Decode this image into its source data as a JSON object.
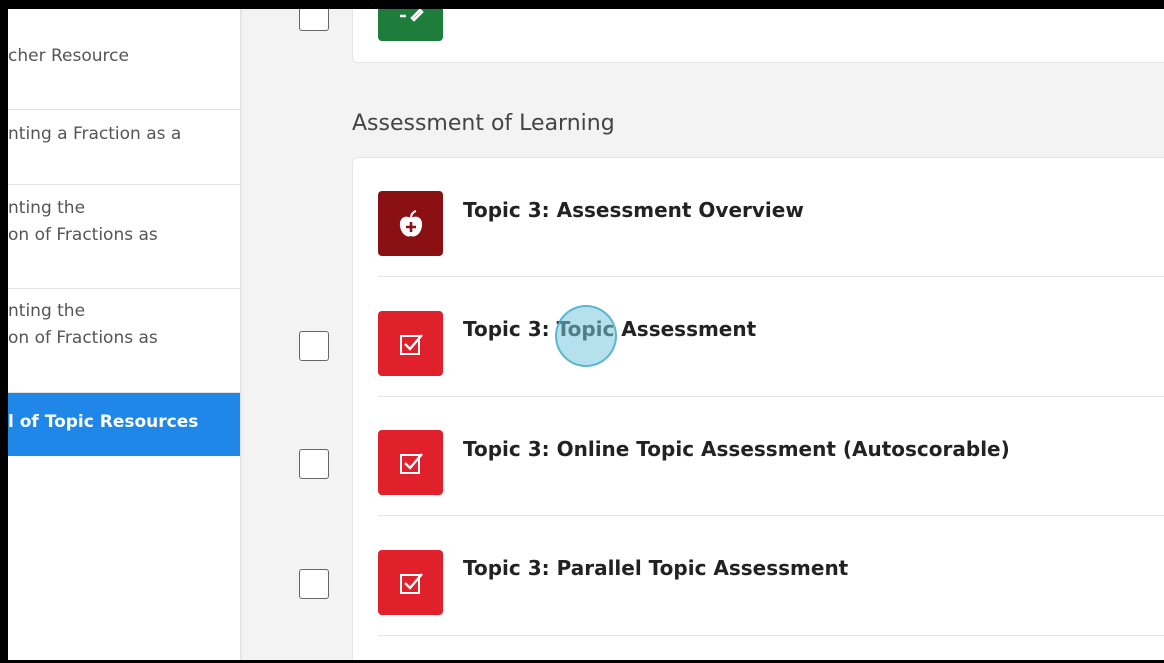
{
  "sidebar": {
    "items": [
      {
        "label": "cher Resource"
      },
      {
        "label": "nting a Fraction as a"
      },
      {
        "label": "nting the\non of Fractions as"
      },
      {
        "label": "nting the\non of Fractions as"
      },
      {
        "label": "l of Topic Resources"
      }
    ]
  },
  "main": {
    "section_title": "Assessment of Learning",
    "rows": [
      {
        "title": "Topic 3: Assessment Overview",
        "icon": "apple-icon"
      },
      {
        "title": "Topic 3: Topic Assessment",
        "icon": "checklist-icon"
      },
      {
        "title": "Topic 3: Online Topic Assessment (Autoscorable)",
        "icon": "checklist-icon"
      },
      {
        "title": "Topic 3: Parallel Topic Assessment",
        "icon": "checklist-icon"
      }
    ]
  },
  "colors": {
    "active_sidebar": "#1f87e8",
    "assessment_tile": "#e0202a",
    "overview_tile": "#8b1014",
    "top_tile": "#1e7d3a"
  }
}
